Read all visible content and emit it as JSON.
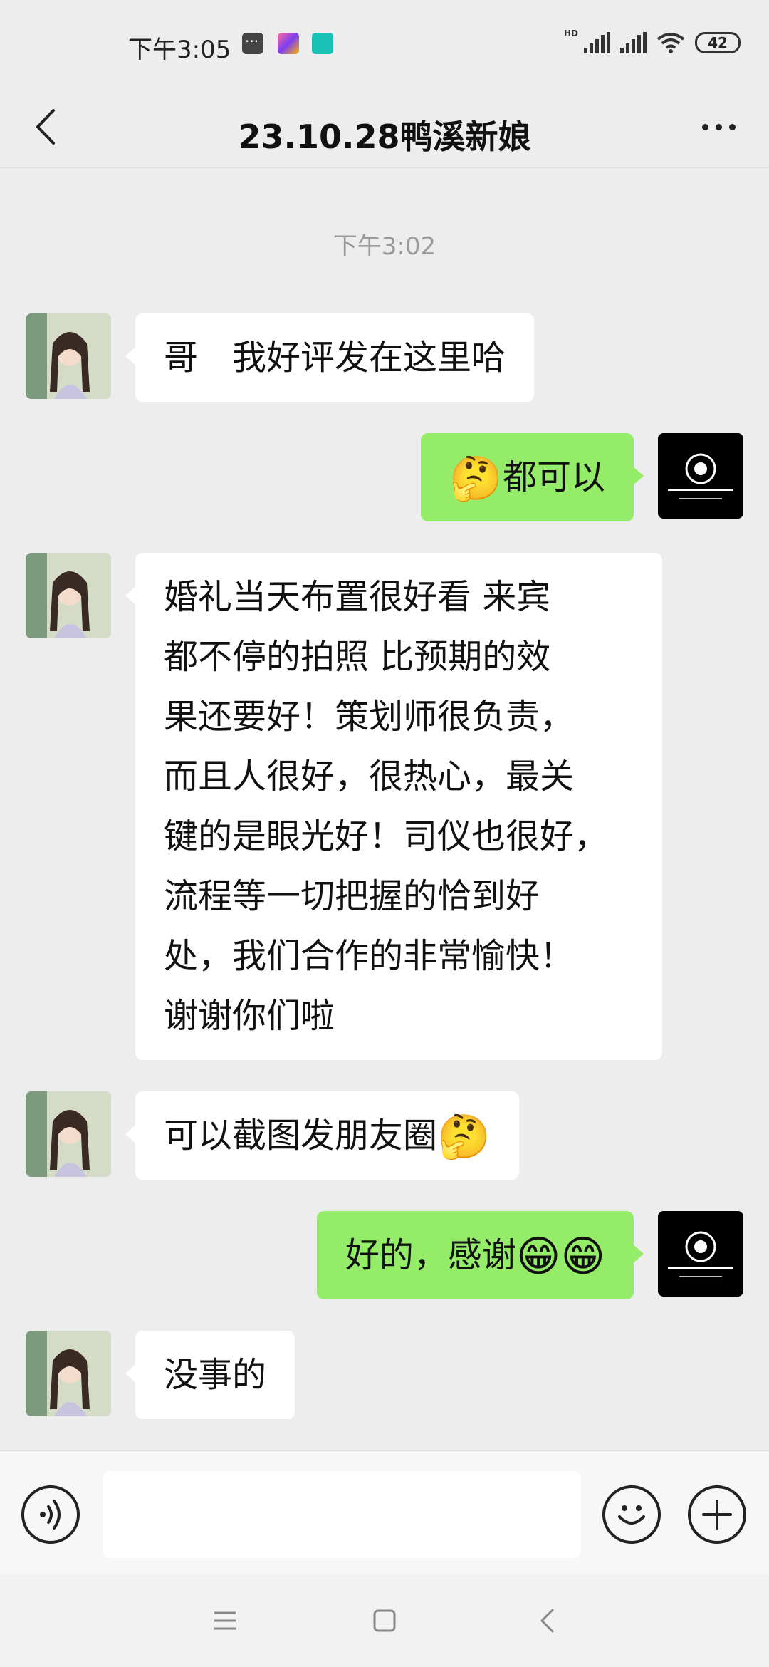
{
  "status_bar": {
    "time": "下午3:05",
    "battery": "42",
    "app_icon_label": "BOSS直聘"
  },
  "header": {
    "title": "23.10.28鸭溪新娘"
  },
  "chat": {
    "timestamp": "下午3:02",
    "messages": [
      {
        "from": "contact",
        "text": "哥　我好评发在这里哈"
      },
      {
        "from": "me",
        "emoji": "🤔",
        "text": "都可以"
      },
      {
        "from": "contact",
        "lines": [
          "婚礼当天布置很好看 来宾",
          "都不停的拍照 比预期的效",
          "果还要好！策划师很负责，",
          "而且人很好，很热心，最关",
          "键的是眼光好！司仪也很好，",
          "流程等一切把握的恰到好",
          "处，我们合作的非常愉快！",
          "谢谢你们啦"
        ]
      },
      {
        "from": "contact",
        "text": "可以截图发朋友圈",
        "emoji": "🤔"
      },
      {
        "from": "me",
        "text": "好的，感谢",
        "emoji": "😁😁"
      },
      {
        "from": "contact",
        "text": "没事的"
      }
    ]
  },
  "input_bar": {
    "placeholder": ""
  },
  "colors": {
    "background": "#ededed",
    "outgoing_bubble": "#95ec69",
    "incoming_bubble": "#ffffff"
  },
  "icons": {
    "back": "chevron-left-icon",
    "more": "more-dots-icon",
    "voice": "voice-icon",
    "emoji": "emoji-icon",
    "plus": "plus-icon"
  }
}
